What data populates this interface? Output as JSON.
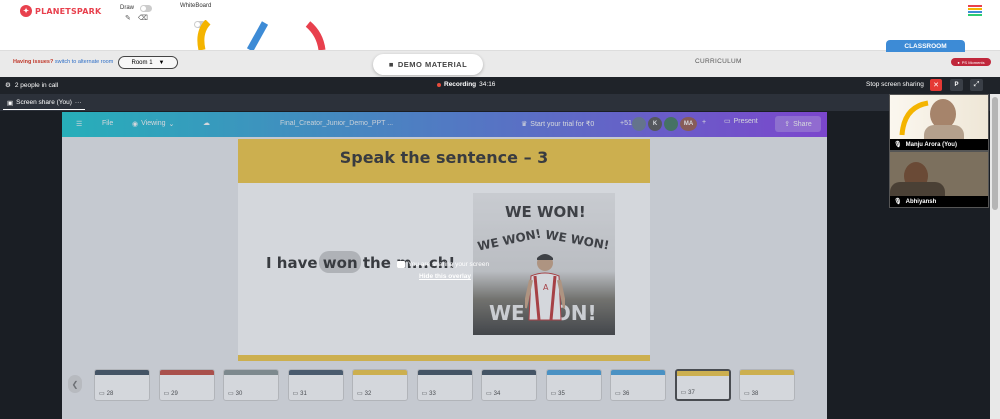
{
  "brand": {
    "name": "PLANETSPARK",
    "accent": "#e8404d"
  },
  "toolbar": {
    "draw_label": "Draw",
    "whiteboard_label": "WhiteBoard",
    "pencil_icon": "pencil-icon",
    "eraser_icon": "eraser-icon"
  },
  "subbar": {
    "issues_text": "Having issues?",
    "switch_text": "switch to alternate room",
    "room_value": "Room 1",
    "demo_material": "DEMO MATERIAL",
    "curriculum": "CURRICULUM",
    "classroom_tab": "CLASSROOM",
    "moments_badge": "PS Moments"
  },
  "call": {
    "people": "2 people in call",
    "recording_label": "Recording",
    "recording_time": "34:16",
    "stop_sharing": "Stop screen sharing",
    "p_button": "P",
    "tab_label": "Screen share (You)",
    "tab_more": "···"
  },
  "shared": {
    "file_menu": "File",
    "viewing": "Viewing",
    "doc_title": "Final_Creator_Junior_Demo_PPT ...",
    "trial": "Start your trial for ₹0",
    "collab_count": "+51",
    "avatar_k": "K",
    "avatar_ma": "MA",
    "plus": "+",
    "present": "Present",
    "share": "Share",
    "slide_title": "Speak the sentence – 3",
    "sentence_a": "I have",
    "sentence_b": "won",
    "sentence_c": "the ",
    "sentence_d": "m...ch!",
    "poster_text": [
      "WE WON!",
      "WE WON!",
      "WE WON!",
      "WE WON!"
    ],
    "overlay_msg": "You are sharing your screen",
    "overlay_link": "Hide this overlay"
  },
  "thumbs": [
    {
      "num": "28",
      "head": "#2c3e50"
    },
    {
      "num": "29",
      "head": "#c0392b"
    },
    {
      "num": "30",
      "head": "#7f8c8d"
    },
    {
      "num": "31",
      "head": "#34495e"
    },
    {
      "num": "32",
      "head": "#f4c430"
    },
    {
      "num": "33",
      "head": "#2c3e50"
    },
    {
      "num": "34",
      "head": "#2c3e50"
    },
    {
      "num": "35",
      "head": "#3498db"
    },
    {
      "num": "36",
      "head": "#3498db"
    },
    {
      "num": "37",
      "head": "#f4c430"
    },
    {
      "num": "38",
      "head": "#f4c430"
    }
  ],
  "participants": [
    {
      "name": "Manju Arora (You)"
    },
    {
      "name": "Abhiyansh"
    }
  ]
}
